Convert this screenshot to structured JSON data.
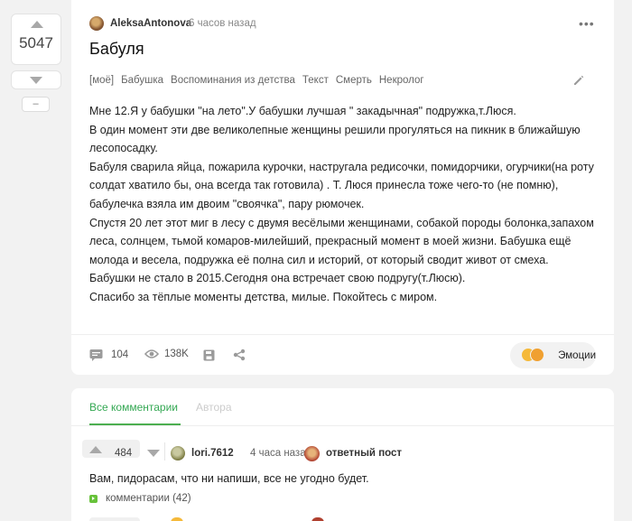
{
  "vote": {
    "count": "5047",
    "collapse_label": "–"
  },
  "story": {
    "author": "AleksaAntonova",
    "time": "6 часов назад",
    "more_label": "•••",
    "title": "Бабуля",
    "tags": [
      "[моё]",
      "Бабушка",
      "Воспоминания из детства",
      "Текст",
      "Смерть",
      "Некролог"
    ],
    "body": [
      "Мне 12.Я у бабушки \"на лето\".У бабушки лучшая \" закадычная\" подружка,т.Люся.",
      "В один момент эти две великолепные женщины решили прогуляться на пикник в ближайшую лесопосадку.",
      "Бабуля сварила яйца, пожарила курочки, настругала редисочки, помидорчики, огурчики(на роту солдат хватило бы, она всегда так готовила) . Т. Люся принесла тоже чего-то (не помню), бабулечка взяла им двоим \"своячка\", пару рюмочек.",
      "Спустя 20 лет этот миг в лесу с двумя весёлыми женщинами, собакой породы болонка,запахом леса, солнцем, тьмой комаров-милейший, прекрасный момент в моей жизни. Бабушка ещё молода и весела, подружка её полна сил и историй, от который сводит живот от смеха.",
      "Бабушки не стало в 2015.Сегодня она встречает свою подругу(т.Люсю).",
      "Спасибо за тёплые моменты детства, милые. Покойтесь с миром."
    ],
    "footer": {
      "comments_count": "104",
      "views_count": "138K",
      "emotions_label": "Эмоции"
    }
  },
  "comments": {
    "tab_all": "Все комментарии",
    "tab_author": "Автора",
    "first": {
      "rating": "484",
      "author": "lori.7612",
      "time": "4 часа назад",
      "badge": "ответный пост",
      "text": "Вам, пидорасам, что ни напиши, все не угодно будет.",
      "replies_label": "комментарии (42)"
    }
  },
  "colors": {
    "accent_green": "#4caf50",
    "tab_active": "#34a853",
    "icon_gray": "#a8a8a8"
  }
}
